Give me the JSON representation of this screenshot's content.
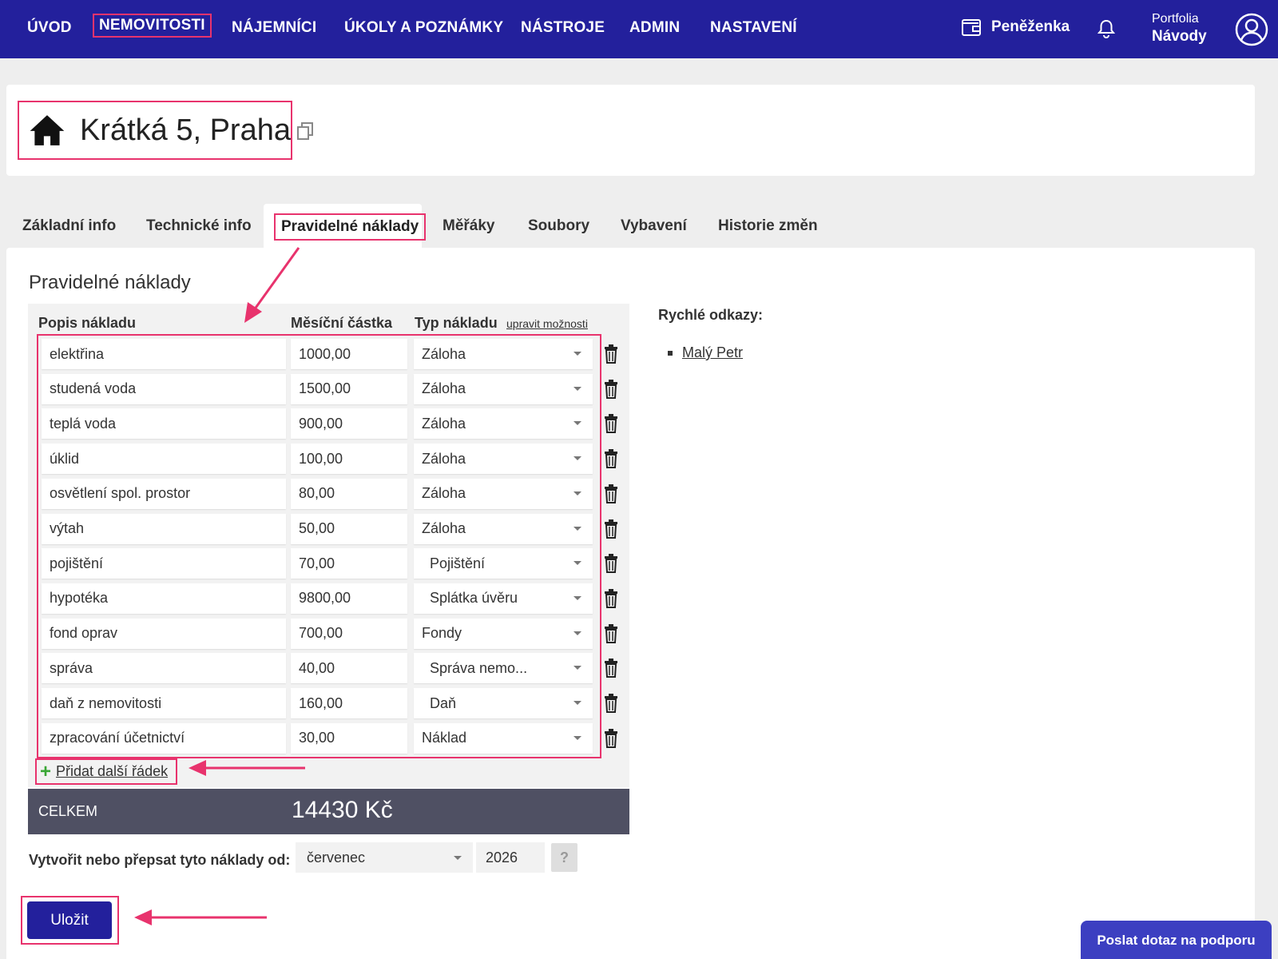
{
  "nav": {
    "items": [
      "ÚVOD",
      "NEMOVITOSTI",
      "NÁJEMNÍCI",
      "ÚKOLY A POZNÁMKY",
      "NÁSTROJE",
      "ADMIN",
      "NASTAVENÍ"
    ],
    "wallet": "Peněženka",
    "portfolio_label": "Portfolia",
    "portfolio_value": "Návody"
  },
  "property": {
    "title": "Krátká 5, Praha"
  },
  "tabs": [
    "Základní info",
    "Technické info",
    "Pravidelné náklady",
    "Měřáky",
    "Soubory",
    "Vybavení",
    "Historie změn"
  ],
  "costs": {
    "section_title": "Pravidelné náklady",
    "headers": {
      "desc": "Popis nákladu",
      "amount": "Měsíční částka",
      "type": "Typ nákladu",
      "edit_options": "upravit možnosti"
    },
    "rows": [
      {
        "desc": "elektřina",
        "amount": "1000,00",
        "type": "Záloha"
      },
      {
        "desc": "studená voda",
        "amount": "1500,00",
        "type": "Záloha"
      },
      {
        "desc": "teplá voda",
        "amount": "900,00",
        "type": "Záloha"
      },
      {
        "desc": "úklid",
        "amount": "100,00",
        "type": "Záloha"
      },
      {
        "desc": "osvětlení spol. prostor",
        "amount": "80,00",
        "type": "Záloha"
      },
      {
        "desc": "výtah",
        "amount": "50,00",
        "type": "Záloha"
      },
      {
        "desc": "pojištění",
        "amount": "70,00",
        "type": "  Pojištění"
      },
      {
        "desc": "hypotéka",
        "amount": "9800,00",
        "type": "  Splátka úvěru"
      },
      {
        "desc": "fond oprav",
        "amount": "700,00",
        "type": "Fondy"
      },
      {
        "desc": "správa",
        "amount": "40,00",
        "type": "  Správa nemo..."
      },
      {
        "desc": "daň z nemovitosti",
        "amount": "160,00",
        "type": "  Daň"
      },
      {
        "desc": "zpracování účetnictví",
        "amount": "30,00",
        "type": "Náklad"
      }
    ],
    "add_row": "Přidat další řádek",
    "total_label": "CELKEM",
    "total_value": "14430 Kč",
    "from_label": "Vytvořit nebo přepsat tyto náklady od:",
    "month": "červenec",
    "year": "2026",
    "help": "?",
    "save": "Uložit"
  },
  "quick_links": {
    "title": "Rychlé odkazy:",
    "items": [
      "Malý Petr"
    ]
  },
  "support": "Poslat dotaz na podporu",
  "colors": {
    "nav_bg": "#23209c",
    "highlight": "#e8336d",
    "total_bar": "#4f5063",
    "add_icon": "#3aa635"
  }
}
